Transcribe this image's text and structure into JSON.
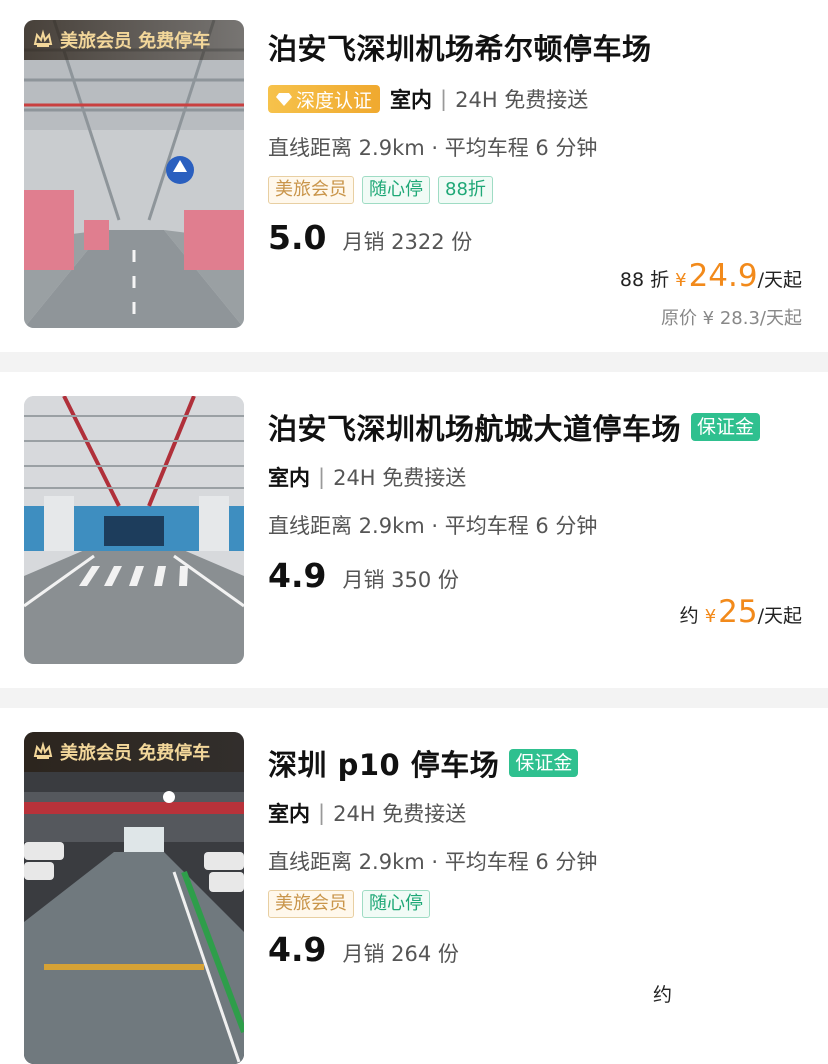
{
  "listings": [
    {
      "member_banner": "美旅会员 免费停车",
      "title": "泊安飞深圳机场希尔顿停车场",
      "cert_badge": "深度认证",
      "indoor": "室内",
      "service": "24H 免费接送",
      "distance": "直线距离 2.9km · 平均车程 6 分钟",
      "tags": [
        "美旅会员",
        "随心停",
        "88折"
      ],
      "rating": "5.0",
      "sales": "月销 2322 份",
      "price_prefix": "88 折",
      "price": "24.9",
      "unit": "/天起",
      "original_price": "原价 ¥ 28.3/天起"
    },
    {
      "title": "泊安飞深圳机场航城大道停车场",
      "deposit_badge": "保证金",
      "indoor": "室内",
      "service": "24H 免费接送",
      "distance": "直线距离 2.9km · 平均车程 6 分钟",
      "rating": "4.9",
      "sales": "月销 350 份",
      "price_prefix": "约",
      "price": "25",
      "unit": "/天起"
    },
    {
      "member_banner": "美旅会员 免费停车",
      "title": "深圳 p10 停车场",
      "deposit_badge": "保证金",
      "indoor": "室内",
      "service": "24H 免费接送",
      "distance": "直线距离 2.9km · 平均车程 6 分钟",
      "tags": [
        "美旅会员",
        "随心停"
      ],
      "rating": "4.9",
      "sales": "月销 264 份",
      "price_prefix": "约"
    }
  ],
  "yen_symbol": "¥",
  "colors": {
    "accent_orange": "#f28a1b",
    "deposit_green": "#2fc08f",
    "gold": "#c9954a"
  }
}
